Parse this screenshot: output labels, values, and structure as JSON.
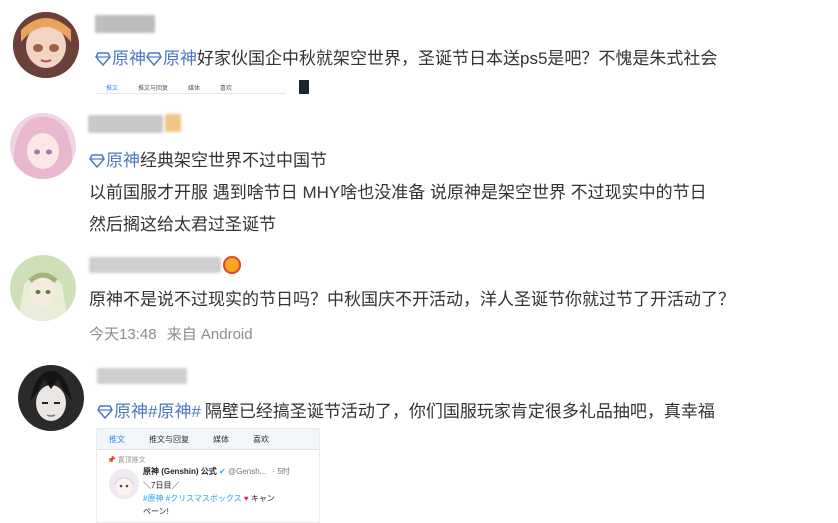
{
  "posts": [
    {
      "tags": [
        "原神",
        "原神"
      ],
      "text": "好家伙国企中秋就架空世界，圣诞节日本送ps5是吧？不愧是朱式社会",
      "mini_tabs": [
        "推文",
        "推文与回复",
        "媒体",
        "喜欢"
      ]
    },
    {
      "tag": "原神",
      "line1": "经典架空世界不过中国节",
      "line2": "以前国服才开服 遇到啥节日 MHY啥也没准备 说原神是架空世界 不过现实中的节日",
      "line3": "然后搁这给太君过圣诞节"
    },
    {
      "text": "原神不是说不过现实的节日吗？中秋国庆不开活动，洋人圣诞节你就过节了开活动了？",
      "time": "今天13:48",
      "source": "来自 Android"
    },
    {
      "tags": [
        "原神",
        "#原神#"
      ],
      "text": "隔壁已经搞圣诞节活动了，你们国服玩家肯定很多礼品抽吧，真幸福",
      "embed": {
        "tabs": [
          "推文",
          "推文与回复",
          "媒体",
          "喜欢"
        ],
        "pinned": "置顶推文",
        "name": "原神 (Genshin) 公式",
        "handle": "@Gensh...",
        "age": "· 5时",
        "body1": "＼7日目／",
        "body2_tag1": "#原神",
        "body2_tag2": "#クリスマスボックス",
        "body2_tail": "キャン",
        "body3": "ペーン!"
      }
    }
  ],
  "colors": {
    "link": "#4b78c2",
    "meta": "#8c8c8c"
  }
}
